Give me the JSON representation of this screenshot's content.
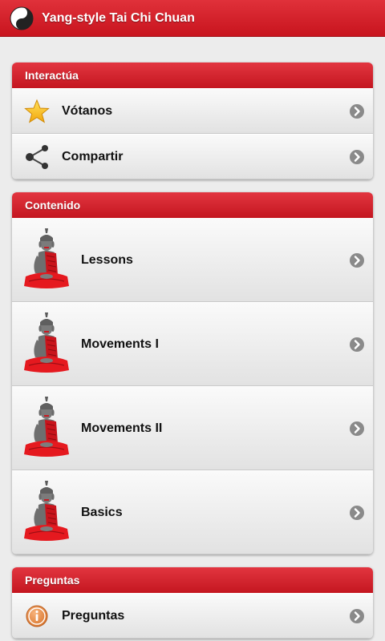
{
  "app": {
    "title": "Yang-style Tai Chi Chuan",
    "logo_icon": "yin-yang-icon"
  },
  "colors": {
    "accent": "#d21f29",
    "chevron": "#8a8a8a"
  },
  "sections": [
    {
      "header": "Interactúa",
      "items": [
        {
          "label": "Vótanos",
          "icon": "star-icon"
        },
        {
          "label": "Compartir",
          "icon": "share-icon"
        }
      ]
    },
    {
      "header": "Contenido",
      "items": [
        {
          "label": "Lessons",
          "icon": "buddha-icon"
        },
        {
          "label": "Movements I",
          "icon": "buddha-icon"
        },
        {
          "label": "Movements II",
          "icon": "buddha-icon"
        },
        {
          "label": "Basics",
          "icon": "buddha-icon"
        }
      ]
    },
    {
      "header": "Preguntas",
      "items": [
        {
          "label": "Preguntas",
          "icon": "info-icon"
        }
      ]
    }
  ]
}
